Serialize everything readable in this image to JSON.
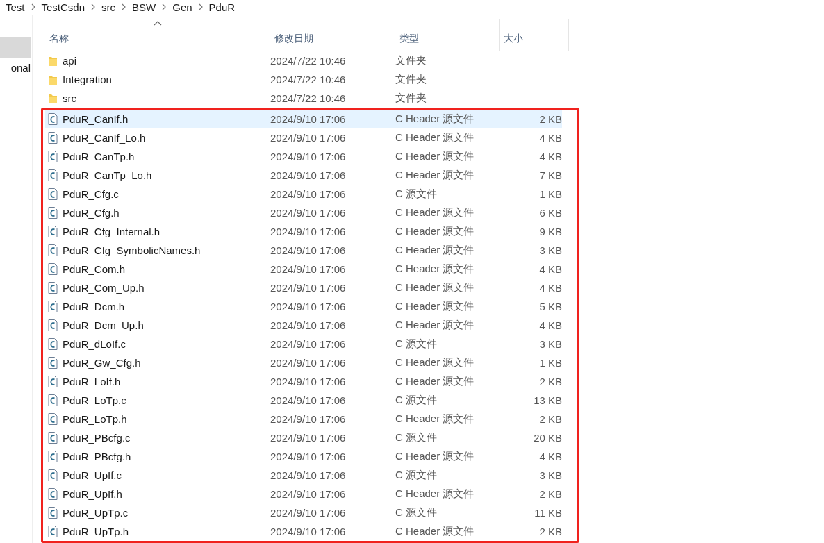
{
  "breadcrumb": [
    "Test",
    "TestCsdn",
    "src",
    "BSW",
    "Gen",
    "PduR"
  ],
  "sidebar": {
    "items": [
      {
        "selected": true
      },
      {
        "label": "onal",
        "selected": false
      }
    ]
  },
  "table": {
    "columns": [
      {
        "label": "名称",
        "sorted": true
      },
      {
        "label": "修改日期",
        "sorted": false
      },
      {
        "label": "类型",
        "sorted": false
      },
      {
        "label": "大小",
        "sorted": false
      }
    ],
    "files_framed": true,
    "rows": [
      {
        "kind": "folder",
        "name": "api",
        "date": "2024/7/22 10:46",
        "type": "文件夹",
        "selected": false
      },
      {
        "kind": "folder",
        "name": "Integration",
        "date": "2024/7/22 10:46",
        "type": "文件夹",
        "selected": false
      },
      {
        "kind": "folder",
        "name": "src",
        "date": "2024/7/22 10:46",
        "type": "文件夹",
        "selected": false
      },
      {
        "kind": "file",
        "name": "PduR_CanIf.h",
        "date": "2024/9/10 17:06",
        "type": "C Header 源文件",
        "size": "2 KB",
        "selected": true
      },
      {
        "kind": "file",
        "name": "PduR_CanIf_Lo.h",
        "date": "2024/9/10 17:06",
        "type": "C Header 源文件",
        "size": "4 KB",
        "selected": false
      },
      {
        "kind": "file",
        "name": "PduR_CanTp.h",
        "date": "2024/9/10 17:06",
        "type": "C Header 源文件",
        "size": "4 KB",
        "selected": false
      },
      {
        "kind": "file",
        "name": "PduR_CanTp_Lo.h",
        "date": "2024/9/10 17:06",
        "type": "C Header 源文件",
        "size": "7 KB",
        "selected": false
      },
      {
        "kind": "file",
        "name": "PduR_Cfg.c",
        "date": "2024/9/10 17:06",
        "type": "C 源文件",
        "size": "1 KB",
        "selected": false
      },
      {
        "kind": "file",
        "name": "PduR_Cfg.h",
        "date": "2024/9/10 17:06",
        "type": "C Header 源文件",
        "size": "6 KB",
        "selected": false
      },
      {
        "kind": "file",
        "name": "PduR_Cfg_Internal.h",
        "date": "2024/9/10 17:06",
        "type": "C Header 源文件",
        "size": "9 KB",
        "selected": false
      },
      {
        "kind": "file",
        "name": "PduR_Cfg_SymbolicNames.h",
        "date": "2024/9/10 17:06",
        "type": "C Header 源文件",
        "size": "3 KB",
        "selected": false
      },
      {
        "kind": "file",
        "name": "PduR_Com.h",
        "date": "2024/9/10 17:06",
        "type": "C Header 源文件",
        "size": "4 KB",
        "selected": false
      },
      {
        "kind": "file",
        "name": "PduR_Com_Up.h",
        "date": "2024/9/10 17:06",
        "type": "C Header 源文件",
        "size": "4 KB",
        "selected": false
      },
      {
        "kind": "file",
        "name": "PduR_Dcm.h",
        "date": "2024/9/10 17:06",
        "type": "C Header 源文件",
        "size": "5 KB",
        "selected": false
      },
      {
        "kind": "file",
        "name": "PduR_Dcm_Up.h",
        "date": "2024/9/10 17:06",
        "type": "C Header 源文件",
        "size": "4 KB",
        "selected": false
      },
      {
        "kind": "file",
        "name": "PduR_dLoIf.c",
        "date": "2024/9/10 17:06",
        "type": "C 源文件",
        "size": "3 KB",
        "selected": false
      },
      {
        "kind": "file",
        "name": "PduR_Gw_Cfg.h",
        "date": "2024/9/10 17:06",
        "type": "C Header 源文件",
        "size": "1 KB",
        "selected": false
      },
      {
        "kind": "file",
        "name": "PduR_LoIf.h",
        "date": "2024/9/10 17:06",
        "type": "C Header 源文件",
        "size": "2 KB",
        "selected": false
      },
      {
        "kind": "file",
        "name": "PduR_LoTp.c",
        "date": "2024/9/10 17:06",
        "type": "C 源文件",
        "size": "13 KB",
        "selected": false
      },
      {
        "kind": "file",
        "name": "PduR_LoTp.h",
        "date": "2024/9/10 17:06",
        "type": "C Header 源文件",
        "size": "2 KB",
        "selected": false
      },
      {
        "kind": "file",
        "name": "PduR_PBcfg.c",
        "date": "2024/9/10 17:06",
        "type": "C 源文件",
        "size": "20 KB",
        "selected": false
      },
      {
        "kind": "file",
        "name": "PduR_PBcfg.h",
        "date": "2024/9/10 17:06",
        "type": "C Header 源文件",
        "size": "4 KB",
        "selected": false
      },
      {
        "kind": "file",
        "name": "PduR_UpIf.c",
        "date": "2024/9/10 17:06",
        "type": "C 源文件",
        "size": "3 KB",
        "selected": false
      },
      {
        "kind": "file",
        "name": "PduR_UpIf.h",
        "date": "2024/9/10 17:06",
        "type": "C Header 源文件",
        "size": "2 KB",
        "selected": false
      },
      {
        "kind": "file",
        "name": "PduR_UpTp.c",
        "date": "2024/9/10 17:06",
        "type": "C 源文件",
        "size": "11 KB",
        "selected": false
      },
      {
        "kind": "file",
        "name": "PduR_UpTp.h",
        "date": "2024/9/10 17:06",
        "type": "C Header 源文件",
        "size": "2 KB",
        "selected": false
      }
    ]
  }
}
